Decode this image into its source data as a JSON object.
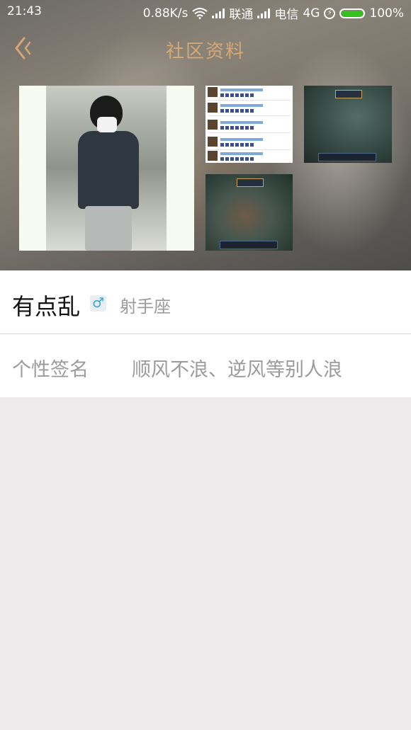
{
  "status_bar": {
    "time": "21:43",
    "net_speed": "0.88K/s",
    "carrier1": "联通",
    "carrier2": "电信",
    "network_type": "4G",
    "battery": "100%",
    "icons": [
      "wifi-icon",
      "signal-icon",
      "charging-icon",
      "battery-icon"
    ],
    "battery_color": "#34c31c"
  },
  "nav": {
    "title": "社区资料",
    "back_icon": "chevron-left-icon",
    "accent_color": "#d7a873"
  },
  "photos": {
    "count": 4
  },
  "profile": {
    "name": "有点乱",
    "gender_symbol": "♂",
    "zodiac": "射手座",
    "signature_label": "个性签名",
    "signature_value": "顺风不浪、逆风等别人浪"
  }
}
